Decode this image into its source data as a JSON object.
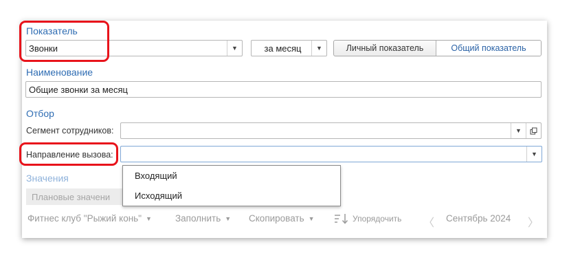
{
  "indicator": {
    "title": "Показатель",
    "value": "Звонки",
    "period": "за месяц",
    "personal_label": "Личный показатель",
    "general_label": "Общий показатель"
  },
  "name": {
    "title": "Наименование",
    "value": "Общие звонки за месяц"
  },
  "filter": {
    "title": "Отбор",
    "segment_label": "Сегмент сотрудников:",
    "segment_value": "",
    "direction_label": "Направление вызова:",
    "direction_value": "",
    "options": [
      "Входящий",
      "Исходящий"
    ]
  },
  "values": {
    "title": "Значения",
    "planned_label": "Плановые значени"
  },
  "toolbar": {
    "club": "Фитнес клуб \"Рыжий конь\"",
    "fill": "Заполнить",
    "copy": "Скопировать",
    "sort": "Упорядочить",
    "month": "Сентябрь 2024",
    "prev_glyph": "〈",
    "next_glyph": "〉"
  },
  "colors": {
    "accent": "#2f6db3",
    "highlight": "#e8131b"
  }
}
